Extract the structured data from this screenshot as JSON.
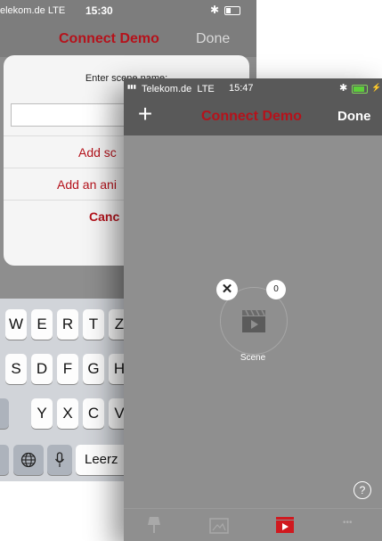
{
  "back": {
    "status": {
      "carrier": "elekom.de",
      "network": "LTE",
      "time": "15:30",
      "bluetooth": "✱"
    },
    "nav": {
      "title": "Connect Demo",
      "done": "Done"
    },
    "sheet": {
      "prompt": "Enter scene name:",
      "input_value": "",
      "actions": [
        "Add sc",
        "Add an ani",
        "Canc"
      ]
    },
    "keyboard": {
      "row1": [
        "W",
        "E",
        "R",
        "T",
        "Z"
      ],
      "row2": [
        "S",
        "D",
        "F",
        "G",
        "H"
      ],
      "row3": [
        "Y",
        "X",
        "C",
        "V"
      ],
      "space": "Leerz"
    }
  },
  "front": {
    "status": {
      "signal": "▮▮▮",
      "carrier": "Telekom.de",
      "network": "LTE",
      "time": "15:47",
      "bluetooth": "✱",
      "charge": "⚡"
    },
    "nav": {
      "add": "+",
      "title": "Connect Demo",
      "done": "Done"
    },
    "scene": {
      "label": "Scene",
      "count": "0",
      "close": "✕"
    },
    "help": "?",
    "tabs": [
      {
        "icon": "lamp-icon"
      },
      {
        "icon": "picture-frame-icon"
      },
      {
        "icon": "scene-clapper-icon",
        "active": true
      },
      {
        "icon": "more-dots-icon",
        "text": "•••"
      }
    ]
  },
  "colors": {
    "accent": "#b5121b",
    "nav_bg": "#595959",
    "content_bg": "#8f8f8f",
    "battery": "#5dd03a"
  }
}
